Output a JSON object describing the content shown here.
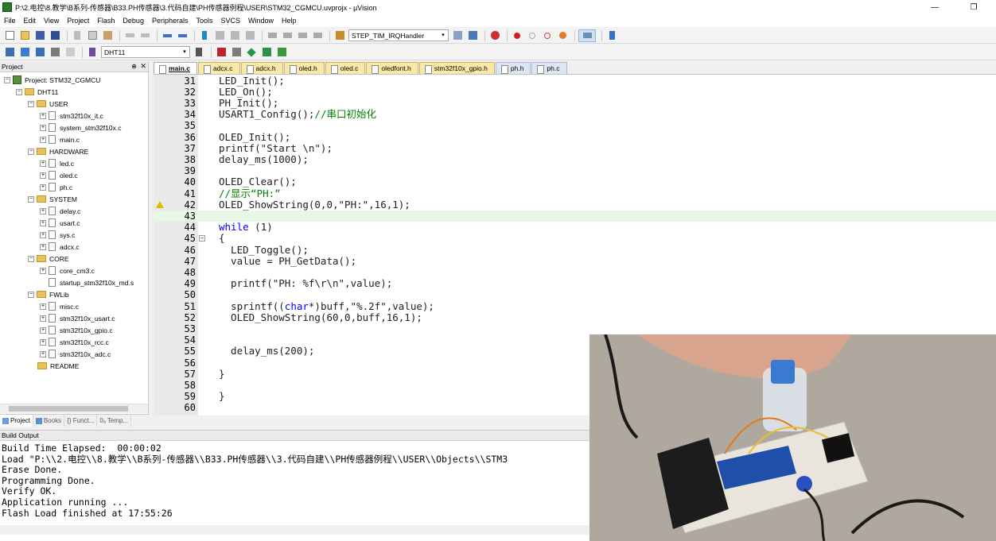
{
  "titlebar": {
    "title": "P:\\2.电控\\8.教学\\B系列-传感器\\B33.PH传感器\\3.代码自建\\PH传感器例程\\USER\\STM32_CGMCU.uvprojx - µVision",
    "minimize": "—",
    "restore": "❐"
  },
  "menubar": [
    "File",
    "Edit",
    "View",
    "Project",
    "Flash",
    "Debug",
    "Peripherals",
    "Tools",
    "SVCS",
    "Window",
    "Help"
  ],
  "toolbar": {
    "function_combo": "STEP_TIM_IRQHandler",
    "target_combo": "DHT11"
  },
  "project_pane": {
    "title": "Project",
    "pin": "⊕",
    "close": "✕",
    "tree": {
      "root": "Project: STM32_CGMCU",
      "target": "DHT11",
      "groups": [
        {
          "name": "USER",
          "files": [
            "stm32f10x_it.c",
            "system_stm32f10x.c",
            "main.c"
          ]
        },
        {
          "name": "HARDWARE",
          "files": [
            "led.c",
            "oled.c",
            "ph.c"
          ]
        },
        {
          "name": "SYSTEM",
          "files": [
            "delay.c",
            "usart.c",
            "sys.c",
            "adcx.c"
          ]
        },
        {
          "name": "CORE",
          "files": [
            "core_cm3.c",
            "startup_stm32f10x_md.s"
          ]
        },
        {
          "name": "FWLib",
          "files": [
            "misc.c",
            "stm32f10x_usart.c",
            "stm32f10x_gpio.c",
            "stm32f10x_rcc.c",
            "stm32f10x_adc.c"
          ]
        },
        {
          "name": "README",
          "files": []
        }
      ]
    },
    "bottom_tabs": [
      "Project",
      "Books",
      "{} Funct...",
      "0ₐ Temp..."
    ]
  },
  "editor": {
    "tabs": [
      {
        "label": "main.c",
        "style": "active"
      },
      {
        "label": "adcx.c",
        "style": "yellow"
      },
      {
        "label": "adcx.h",
        "style": "yellow"
      },
      {
        "label": "oled.h",
        "style": "yellow"
      },
      {
        "label": "oled.c",
        "style": "yellow"
      },
      {
        "label": "oledfont.h",
        "style": "yellow"
      },
      {
        "label": "stm32f10x_gpio.h",
        "style": "yellow"
      },
      {
        "label": "ph.h",
        "style": "blue"
      },
      {
        "label": "ph.c",
        "style": "blue"
      }
    ],
    "lines": [
      {
        "num": "31",
        "code": "LED_Init();"
      },
      {
        "num": "32",
        "code": "LED_On();"
      },
      {
        "num": "33",
        "code": "PH_Init();"
      },
      {
        "num": "34",
        "code": "USART1_Config();//串口初始化"
      },
      {
        "num": "35",
        "code": ""
      },
      {
        "num": "36",
        "code": "OLED_Init();"
      },
      {
        "num": "37",
        "code": "printf(\"Start \\n\");"
      },
      {
        "num": "38",
        "code": "delay_ms(1000);"
      },
      {
        "num": "39",
        "code": ""
      },
      {
        "num": "40",
        "code": "OLED_Clear();"
      },
      {
        "num": "41",
        "code": "//显示“PH:”"
      },
      {
        "num": "42",
        "code": "OLED_ShowString(0,0,\"PH:\",16,1);"
      },
      {
        "num": "43",
        "code": ""
      },
      {
        "num": "44",
        "code": "while (1)"
      },
      {
        "num": "45",
        "code": "{"
      },
      {
        "num": "46",
        "code": "  LED_Toggle();"
      },
      {
        "num": "47",
        "code": "  value = PH_GetData();"
      },
      {
        "num": "48",
        "code": ""
      },
      {
        "num": "49",
        "code": "  printf(\"PH: %f\\r\\n\",value);"
      },
      {
        "num": "50",
        "code": ""
      },
      {
        "num": "51",
        "code": "  sprintf((char*)buff,\"%.2f\",value);"
      },
      {
        "num": "52",
        "code": "  OLED_ShowString(60,0,buff,16,1);"
      },
      {
        "num": "53",
        "code": ""
      },
      {
        "num": "54",
        "code": ""
      },
      {
        "num": "55",
        "code": "  delay_ms(200);"
      },
      {
        "num": "56",
        "code": ""
      },
      {
        "num": "57",
        "code": "}"
      },
      {
        "num": "58",
        "code": ""
      },
      {
        "num": "59",
        "code": "}"
      },
      {
        "num": "60",
        "code": ""
      }
    ]
  },
  "build_output": {
    "title": "Build Output",
    "lines": [
      "Build Time Elapsed:  00:00:02",
      "Load \"P:\\\\2.电控\\\\8.教学\\\\B系列-传感器\\\\B33.PH传感器\\\\3.代码自建\\\\PH传感器例程\\\\USER\\\\Objects\\\\STM3",
      "Erase Done.",
      "Programming Done.",
      "Verify OK.",
      "Application running ...",
      "Flash Load finished at 17:55:26"
    ]
  }
}
